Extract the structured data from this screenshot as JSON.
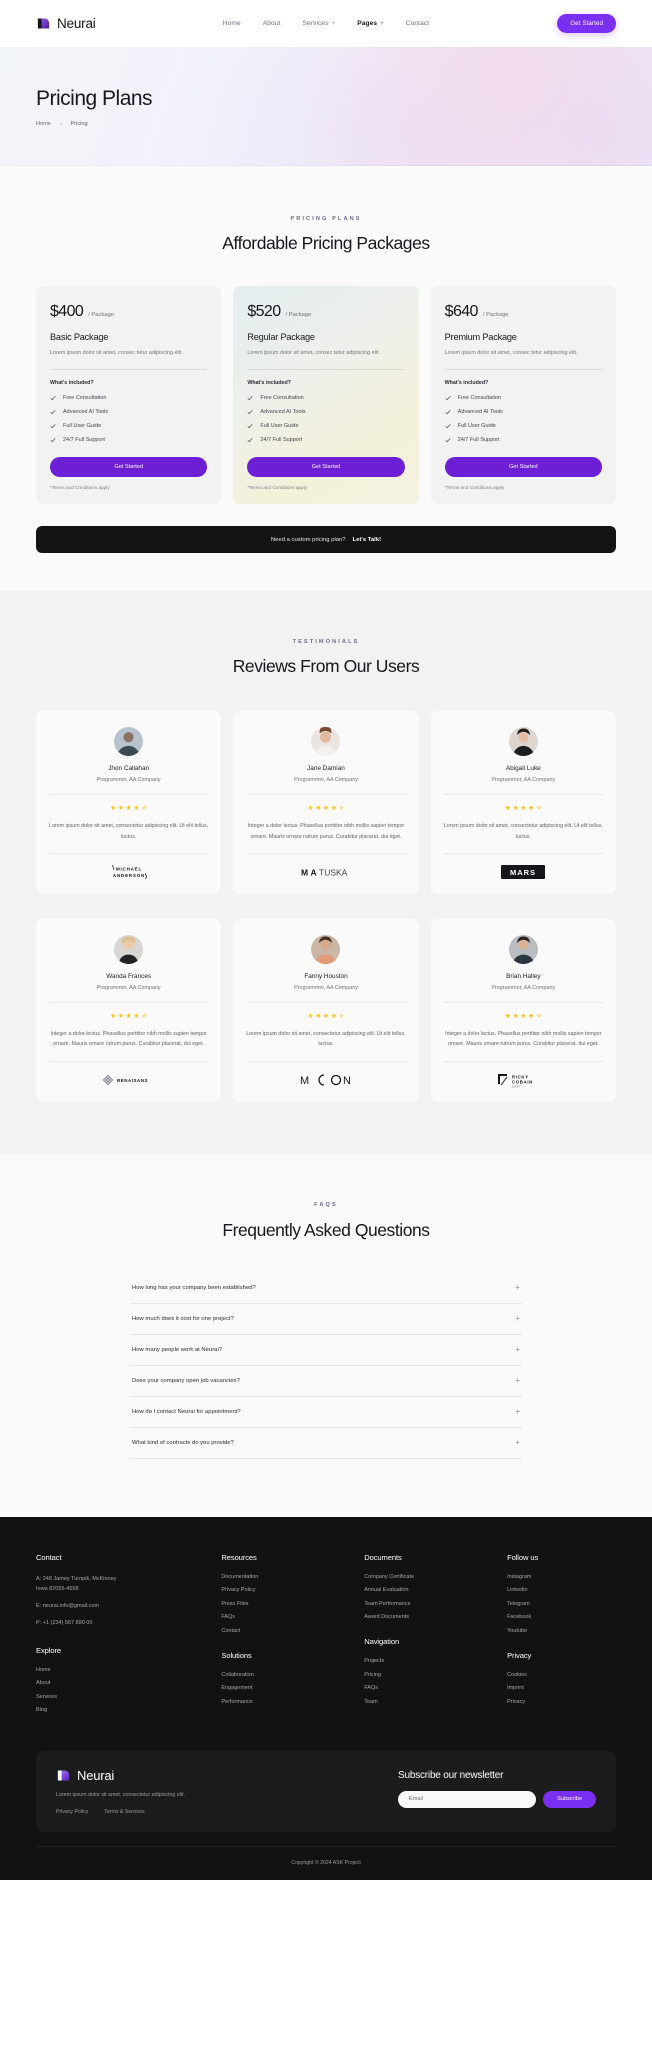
{
  "nav": {
    "brand": "Neurai",
    "brand_icon": "neurai-logo-icon",
    "links": [
      {
        "label": "Home",
        "caret": ""
      },
      {
        "label": "About",
        "caret": ""
      },
      {
        "label": "Services",
        "caret": "+"
      },
      {
        "label": "Pages",
        "caret": "+"
      },
      {
        "label": "Contact",
        "caret": ""
      }
    ],
    "cta": "Get Started"
  },
  "hero": {
    "title": "Pricing Plans",
    "crumb_home": "Home",
    "crumb_arrow": "→",
    "crumb_current": "Pricing"
  },
  "pricing": {
    "eyebrow": "PRICING PLANS",
    "title": "Affordable Pricing Packages",
    "included_label": "What's included?",
    "cta_label": "Get Started",
    "terms": "*Terms and Conditions apply",
    "plans": [
      {
        "price": "$400",
        "per": "/ Package",
        "name": "Basic Package",
        "desc": "Lorem ipsum dolor sit amet, consec tetur adipiscing elit.",
        "features": [
          "Free Consultation",
          "Advanced AI Tools",
          "Full User Guide",
          "24/7 Full Support"
        ]
      },
      {
        "price": "$520",
        "per": "/ Package",
        "name": "Regular Package",
        "desc": "Lorem ipsum dolor sit amet, consec tetur adipiscing elit.",
        "features": [
          "Free Consultation",
          "Advanced AI Tools",
          "Full User Guide",
          "24/7 Full Support"
        ]
      },
      {
        "price": "$640",
        "per": "/ Package",
        "name": "Premium Package",
        "desc": "Lorem ipsum dolor sit amet, consec tetur adipiscing elit.",
        "features": [
          "Free Consultation",
          "Advanced AI Tools",
          "Full User Guide",
          "24/7 Full Support"
        ]
      }
    ],
    "custom_bar_text": "Need a custom pricing plan?",
    "custom_bar_link": "Let's Talk!"
  },
  "testimonials": {
    "eyebrow": "TESTIMONIALS",
    "title": "Reviews From Our Users",
    "cards": [
      {
        "name": "Jhon Callahan",
        "role": "Programmer, AA Company",
        "rating": 4.5,
        "text": "Lorem ipsum dolor sit amet, consectetur adipiscing elit. Ut elit tellus, luctus.",
        "logo": "MICHAEL ANDERSON",
        "logo_icon": "signature-logo-icon"
      },
      {
        "name": "Jane Damian",
        "role": "Programmer, AA Company",
        "rating": 4.5,
        "text": "Integer a dolor lectus. Phasellus porttitor nibh mollis sapien tempor ornare. Mauris ornare rutrum purus. Curabitur placerat, dui eget.",
        "logo": "MATUSKA",
        "logo_icon": "matuska-logo-icon"
      },
      {
        "name": "Abigail Luke",
        "role": "Programmer, AA Company",
        "rating": 4.5,
        "text": "Lorem ipsum dolor sit amet, consectetur adipiscing elit. Ut elit tellus, luctus.",
        "logo": "MARS",
        "logo_icon": "mars-logo-icon"
      },
      {
        "name": "Wanda Frances",
        "role": "Programmer, AA Company",
        "rating": 4.5,
        "text": "Integer a dolor lectus. Phasellus porttitor nibh mollis sapien tempor ornare. Mauris ornare rutrum purus. Curabitur placerat, dui eget.",
        "logo": "RENAISANS",
        "logo_icon": "renaisans-logo-icon"
      },
      {
        "name": "Fanny Houston",
        "role": "Programmer, AA Company",
        "rating": 4.5,
        "text": "Lorem ipsum dolor sit amet, consectetur adipiscing elit. Ut elit tellus, luctus.",
        "logo": "MOON",
        "logo_icon": "moon-logo-icon"
      },
      {
        "name": "Brian Halley",
        "role": "Programmer, AA Company",
        "rating": 4.5,
        "text": "Integer a dolor lectus. Phasellus porttitor nibh mollis sapien tempor ornare. Mauris ornare rutrum purus. Curabitur placerat, dui eget.",
        "logo": "RICKY COBAIN 1997",
        "logo_icon": "ricky-cobain-logo-icon"
      }
    ]
  },
  "faq": {
    "eyebrow": "FAQS",
    "title": "Frequently Asked Questions",
    "plus": "+",
    "items": [
      "How long has your company been established?",
      "How much does it cost for one project?",
      "How many people work at Neurai?",
      "Does your company open job vacancies?",
      "How do I contact Neurai for appointment?",
      "What kind of contracts do you provide?"
    ]
  },
  "footer": {
    "contact_heading": "Contact",
    "contact_lines": [
      "A: 248 Jamey Turnpik, McKinney",
      "Iowa 82055-4558",
      "E: neurai.info@gmail.com",
      "P: +1 (234) 567 890 00"
    ],
    "explore_heading": "Explore",
    "explore_links": [
      "Home",
      "About",
      "Services",
      "Blog"
    ],
    "resources_heading": "Resources",
    "resources_links": [
      "Documentation",
      "Privacy Policy",
      "Press Files",
      "FAQs",
      "Contact"
    ],
    "solutions_heading": "Solutions",
    "solutions_links": [
      "Collaboration",
      "Engagement",
      "Performance"
    ],
    "documents_heading": "Documents",
    "documents_links": [
      "Company Certificate",
      "Annual Evaluation",
      "Team Performance",
      "Award Documents"
    ],
    "navigation_heading": "Navigation",
    "navigation_links": [
      "Projects",
      "Pricing",
      "FAQs",
      "Team"
    ],
    "follow_heading": "Follow us",
    "follow_links": [
      "Instagram",
      "Linkedin",
      "Telegram",
      "Facebook",
      "Youtube"
    ],
    "privacy_heading": "Privacy",
    "privacy_links": [
      "Cookies",
      "Imprint",
      "Privacy"
    ],
    "newsletter": {
      "brand": "Neurai",
      "desc": "Lorem ipsum dolor sit amet, consectetur adipiscing elit.",
      "links": [
        "Privacy Policy",
        "Terms & Services"
      ],
      "title": "Subscribe our newsletter",
      "input_placeholder": "Email",
      "button": "Subscribe"
    },
    "copyright": "Copyright © 2024 ASK Project"
  },
  "colors": {
    "accent": "#7b2ff2",
    "plan_cta": "#6d1fd6",
    "star": "#f5c518",
    "dark": "#121212"
  }
}
